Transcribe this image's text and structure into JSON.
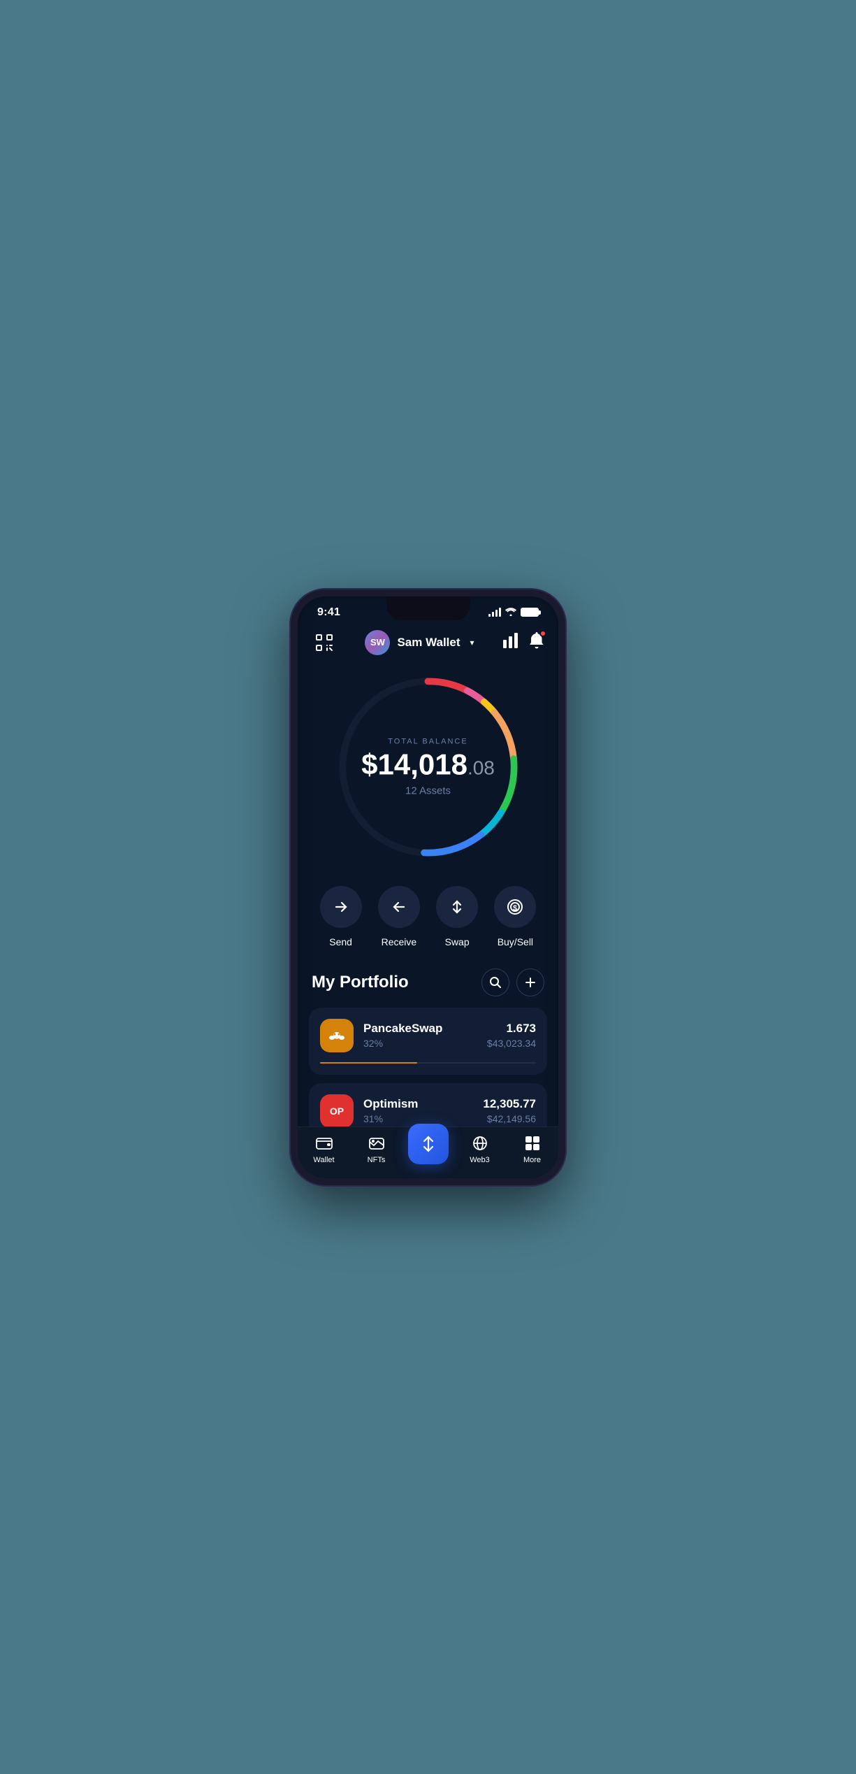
{
  "statusBar": {
    "time": "9:41",
    "signalBars": [
      4,
      6,
      9,
      12
    ],
    "batteryFull": true
  },
  "header": {
    "scanIconLabel": "scan",
    "avatarInitials": "SW",
    "walletName": "Sam Wallet",
    "chevron": "▾",
    "chartIconLabel": "chart",
    "notifIconLabel": "bell"
  },
  "balance": {
    "label": "TOTAL BALANCE",
    "whole": "$14,018",
    "decimal": ".08",
    "assets": "12 Assets"
  },
  "actions": [
    {
      "id": "send",
      "label": "Send",
      "icon": "→"
    },
    {
      "id": "receive",
      "label": "Receive",
      "icon": "←"
    },
    {
      "id": "swap",
      "label": "Swap",
      "icon": "⇅"
    },
    {
      "id": "buysell",
      "label": "Buy/Sell",
      "icon": "$"
    }
  ],
  "portfolio": {
    "title": "My Portfolio",
    "searchLabel": "search",
    "addLabel": "add",
    "assets": [
      {
        "id": "pancakeswap",
        "name": "PancakeSwap",
        "percent": "32%",
        "amount": "1.673",
        "usd": "$43,023.34",
        "progressColor": "#d4820a",
        "progressWidth": 45,
        "logoColor": "#d4820a",
        "logoIcon": "🥞"
      },
      {
        "id": "optimism",
        "name": "Optimism",
        "percent": "31%",
        "amount": "12,305.77",
        "usd": "$42,149.56",
        "progressColor": "#e03030",
        "progressWidth": 42,
        "logoColor": "#e03030",
        "logoIcon": "OP"
      }
    ]
  },
  "bottomNav": {
    "items": [
      {
        "id": "wallet",
        "label": "Wallet",
        "icon": "wallet"
      },
      {
        "id": "nfts",
        "label": "NFTs",
        "icon": "nfts"
      },
      {
        "id": "center",
        "label": "",
        "icon": "swap-center"
      },
      {
        "id": "web3",
        "label": "Web3",
        "icon": "web3"
      },
      {
        "id": "more",
        "label": "More",
        "icon": "more"
      }
    ]
  },
  "donut": {
    "segments": [
      {
        "color": "#e63946",
        "offset": 0,
        "length": 40
      },
      {
        "color": "#e85d9a",
        "offset": 40,
        "length": 20
      },
      {
        "color": "#f5c518",
        "offset": 60,
        "length": 15
      },
      {
        "color": "#f4a261",
        "offset": 75,
        "length": 50
      },
      {
        "color": "#2dc653",
        "offset": 125,
        "length": 55
      },
      {
        "color": "#2563eb",
        "offset": 180,
        "length": 60
      },
      {
        "color": "#06b6d4",
        "offset": 240,
        "length": 30
      }
    ],
    "circumference": 796,
    "radius": 127
  }
}
